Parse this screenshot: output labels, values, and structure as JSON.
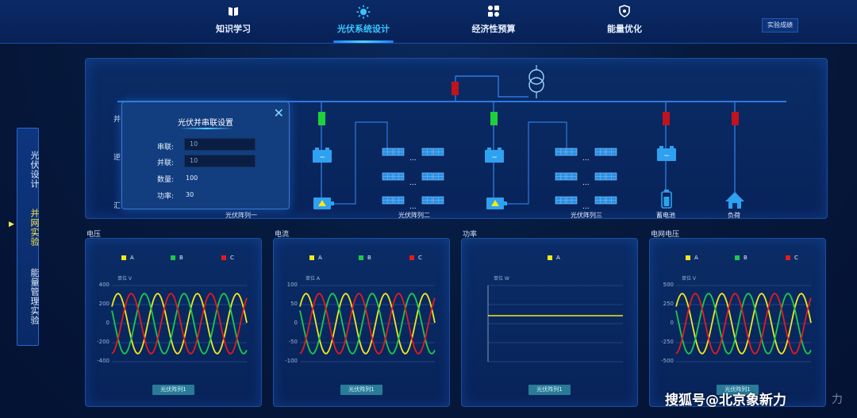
{
  "nav": {
    "items": [
      {
        "label": "知识学习",
        "icon": "book-icon"
      },
      {
        "label": "光伏系统设计",
        "icon": "sun-icon"
      },
      {
        "label": "经济性预算",
        "icon": "grid-icon"
      },
      {
        "label": "能量优化",
        "icon": "shield-icon"
      }
    ],
    "active_index": 1,
    "score_button": "实验成绩"
  },
  "sidebar": {
    "items": [
      "光伏设计",
      "并网实验",
      "能量管理实验"
    ],
    "active_index": 1
  },
  "diagram": {
    "row_labels": [
      "并",
      "逆",
      "汇"
    ],
    "array_labels": [
      "光伏阵列一",
      "光伏阵列二",
      "光伏阵列三"
    ],
    "storage_label": "蓄电池",
    "load_label": "负荷",
    "panel_ellipsis": "...",
    "colors": {
      "switch_closed": "#1fd13a",
      "switch_open": "#c2121d",
      "bus": "#2e78e0"
    }
  },
  "popup": {
    "title": "光伏并串联设置",
    "fields": [
      {
        "label": "串联:",
        "value": "10"
      },
      {
        "label": "并联:",
        "value": "10"
      }
    ],
    "info": [
      {
        "label": "数量:",
        "value": "100"
      },
      {
        "label": "功率:",
        "value": "30"
      }
    ]
  },
  "panels": [
    {
      "title": "电压",
      "unit": "单位 V",
      "ticks": [
        "400",
        "200",
        "0",
        "-200",
        "-400"
      ],
      "button": "光伏阵列1",
      "legend": [
        "A",
        "B",
        "C"
      ]
    },
    {
      "title": "电流",
      "unit": "单位 A",
      "ticks": [
        "100",
        "50",
        "0",
        "-50",
        "-100"
      ],
      "button": "光伏阵列1",
      "legend": [
        "A",
        "B",
        "C"
      ]
    },
    {
      "title": "功率",
      "unit": "单位 W",
      "ticks": [],
      "button": "光伏阵列1",
      "legend": [
        "A"
      ]
    },
    {
      "title": "电网电压",
      "unit": "单位 V",
      "ticks": [
        "500",
        "250",
        "0",
        "-250",
        "-500"
      ],
      "button": "光伏阵列1",
      "legend": [
        "A",
        "B",
        "C"
      ]
    }
  ],
  "legend_colors": {
    "A": "#f2e81a",
    "B": "#1ec94a",
    "C": "#e51b1b"
  },
  "watermark": "搜狐号@北京象新力"
}
